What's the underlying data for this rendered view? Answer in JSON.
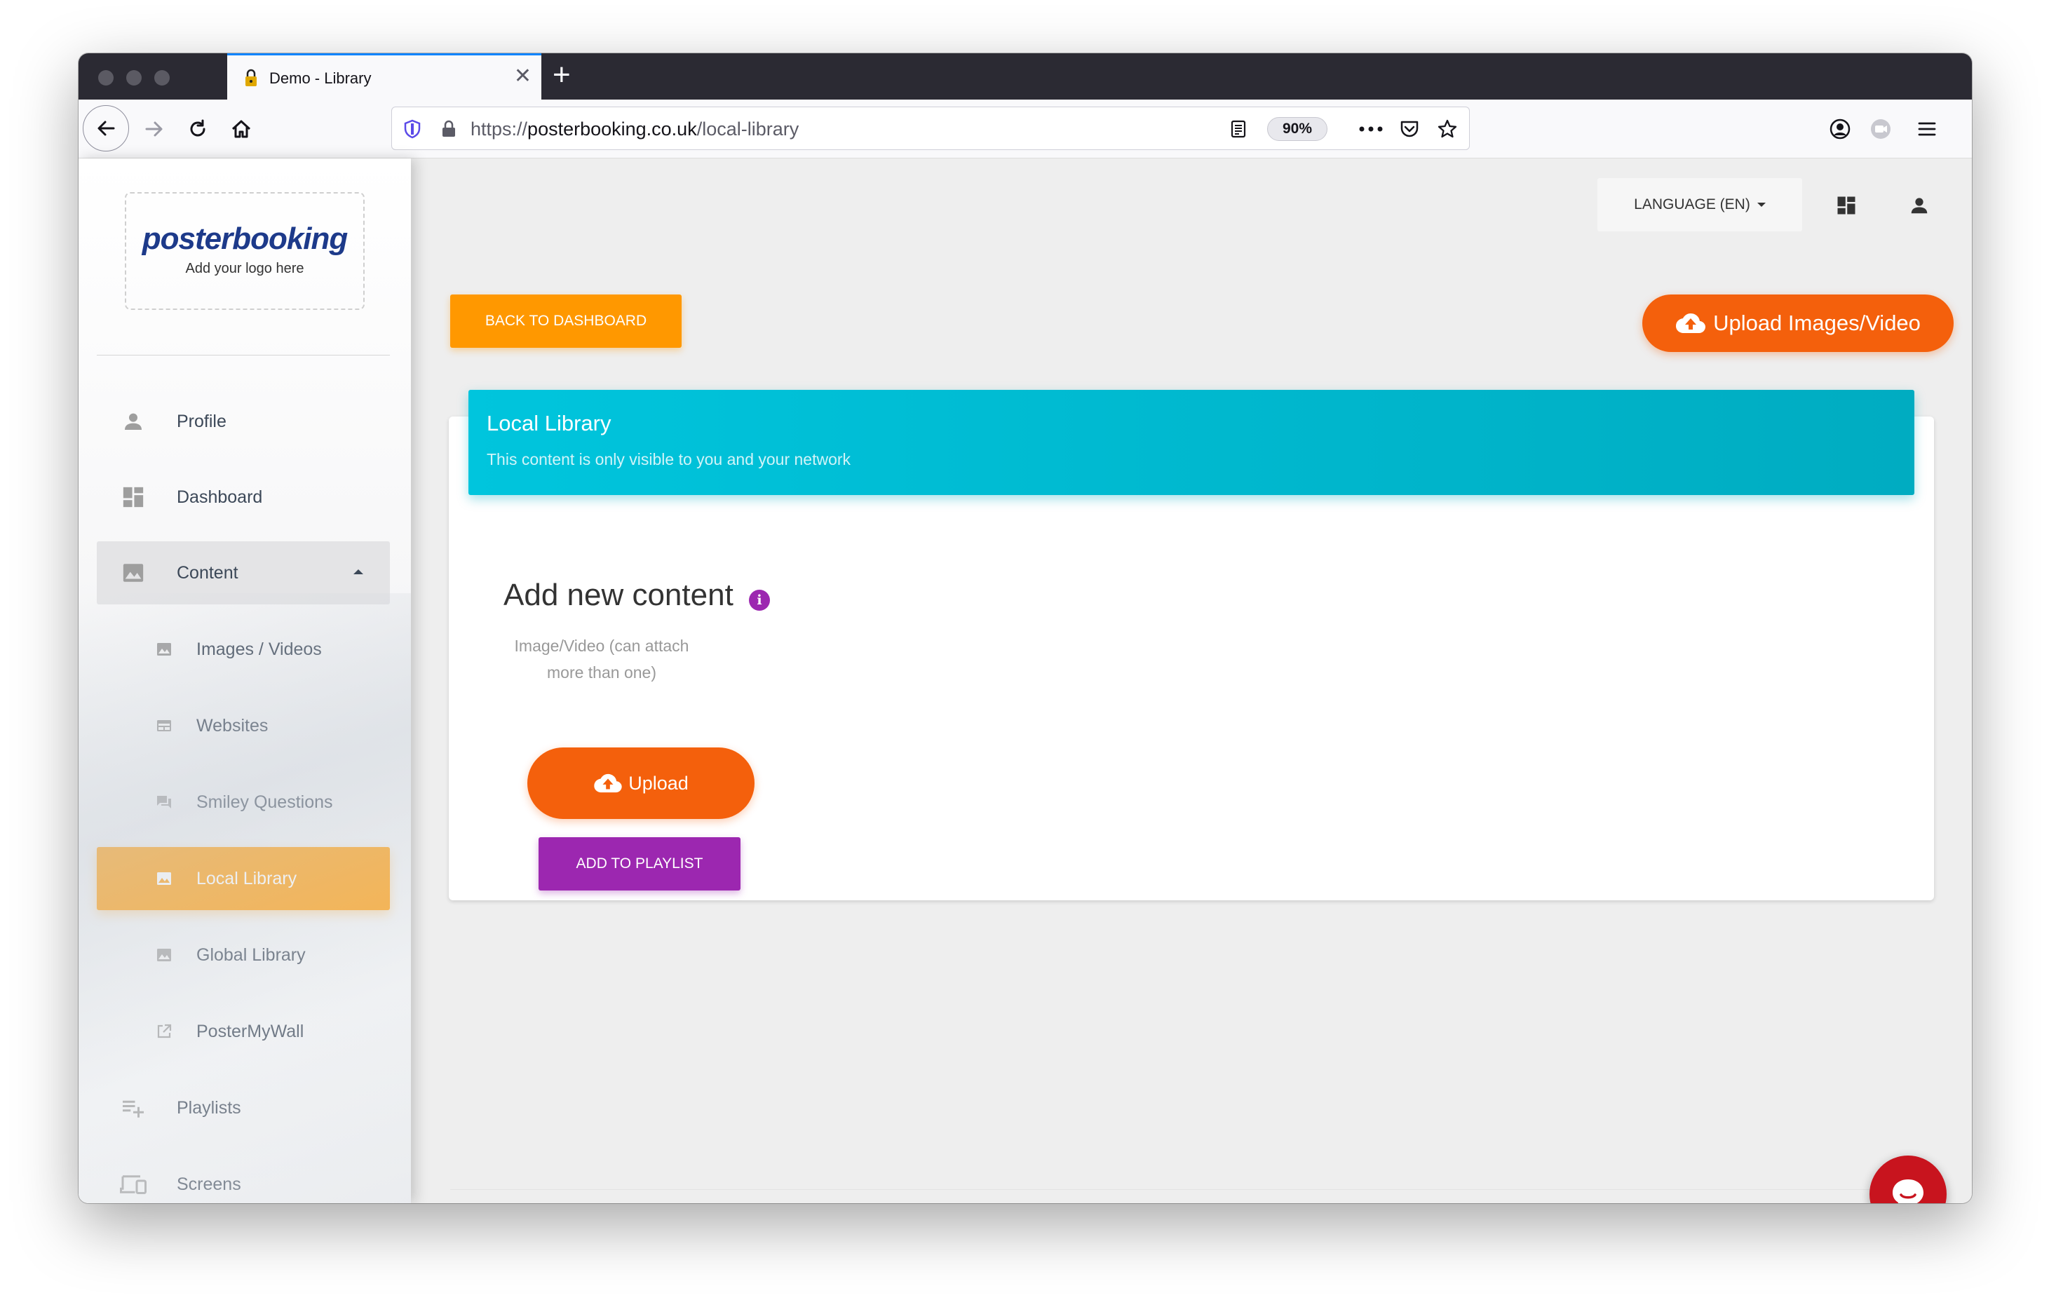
{
  "browser": {
    "tab_title": "Demo - Library",
    "url_scheme": "https://",
    "url_domain": "posterbooking.co.uk",
    "url_path": "/local-library",
    "zoom": "90%"
  },
  "sidebar": {
    "logo_text": "posterbooking",
    "logo_sub": "Add your logo here",
    "items": [
      {
        "label": "Profile",
        "icon": "person-icon"
      },
      {
        "label": "Dashboard",
        "icon": "dashboard-icon"
      },
      {
        "label": "Content",
        "icon": "image-icon",
        "expanded": true
      },
      {
        "label": "Images / Videos",
        "icon": "image-icon"
      },
      {
        "label": "Websites",
        "icon": "web-icon"
      },
      {
        "label": "Smiley Questions",
        "icon": "chat-icon"
      },
      {
        "label": "Local Library",
        "icon": "image-icon",
        "active": true
      },
      {
        "label": "Global Library",
        "icon": "image-icon"
      },
      {
        "label": "PosterMyWall",
        "icon": "external-link-icon"
      },
      {
        "label": "Playlists",
        "icon": "playlist-add-icon"
      },
      {
        "label": "Screens",
        "icon": "devices-icon"
      }
    ]
  },
  "header": {
    "language_label": "LANGUAGE (EN)"
  },
  "actions": {
    "back_label": "BACK TO DASHBOARD",
    "upload_top_label": "Upload Images/Video"
  },
  "card": {
    "title": "Local Library",
    "subtitle": "This content is only visible to you and your network",
    "add_title": "Add new content",
    "hint": "Image/Video (can attach more than one)",
    "upload_label": "Upload",
    "playlist_label": "ADD TO PLAYLIST"
  },
  "colors": {
    "accent_orange": "#ff9800",
    "upload_orange": "#f4600c",
    "header_cyan": "#00bcd4",
    "purple": "#9c27b0",
    "chat_red": "#c8141e"
  }
}
